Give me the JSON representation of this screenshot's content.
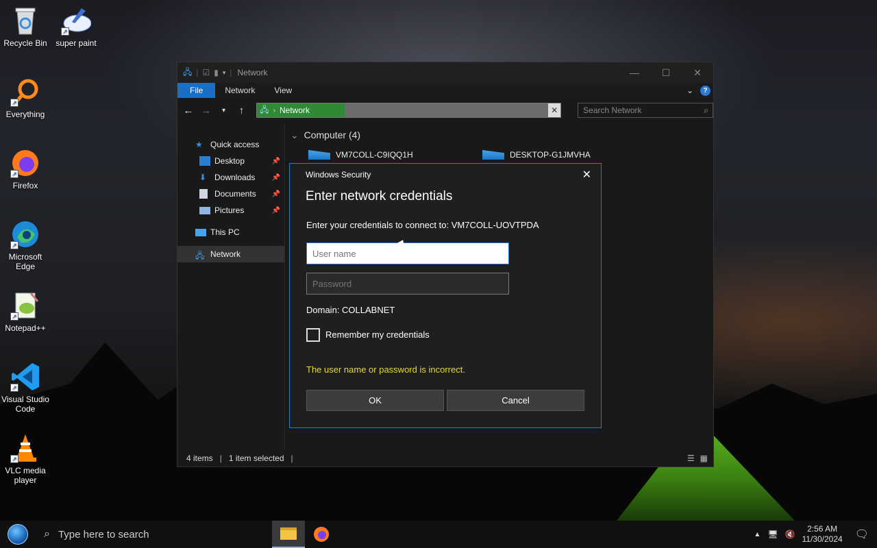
{
  "desktop": {
    "icons": [
      {
        "label": "Recycle Bin"
      },
      {
        "label": "super paint"
      },
      {
        "label": "Everything"
      },
      {
        "label": "Firefox"
      },
      {
        "label": "Microsoft Edge"
      },
      {
        "label": "Notepad++"
      },
      {
        "label": "Visual Studio Code"
      },
      {
        "label": "VLC media player"
      }
    ]
  },
  "explorer": {
    "title": "Network",
    "ribbon_tabs": [
      "File",
      "Network",
      "View"
    ],
    "address_crumb": "Network",
    "search_placeholder": "Search Network",
    "nav": {
      "quick_access": "Quick access",
      "desktop": "Desktop",
      "downloads": "Downloads",
      "documents": "Documents",
      "pictures": "Pictures",
      "this_pc": "This PC",
      "network": "Network"
    },
    "group_header": "Computer (4)",
    "computers": [
      "VM7COLL-C9IQQ1H",
      "DESKTOP-G1JMVHA"
    ],
    "status": {
      "items": "4 items",
      "selected": "1 item selected"
    }
  },
  "dialog": {
    "title": "Windows Security",
    "heading": "Enter network credentials",
    "prompt": "Enter your credentials to connect to: VM7COLL-UOVTPDA",
    "username_placeholder": "User name",
    "password_placeholder": "Password",
    "domain": "Domain: COLLABNET",
    "remember_label": "Remember my credentials",
    "error": "The user name or password is incorrect.",
    "ok_label": "OK",
    "cancel_label": "Cancel"
  },
  "taskbar": {
    "search_placeholder": "Type here to search",
    "time": "2:56 AM",
    "date": "11/30/2024"
  },
  "colors": {
    "accent": "#2b78d0",
    "file_tab": "#1a6fc4",
    "error_text": "#e8d63a",
    "address_highlight": "#2f8a36"
  }
}
